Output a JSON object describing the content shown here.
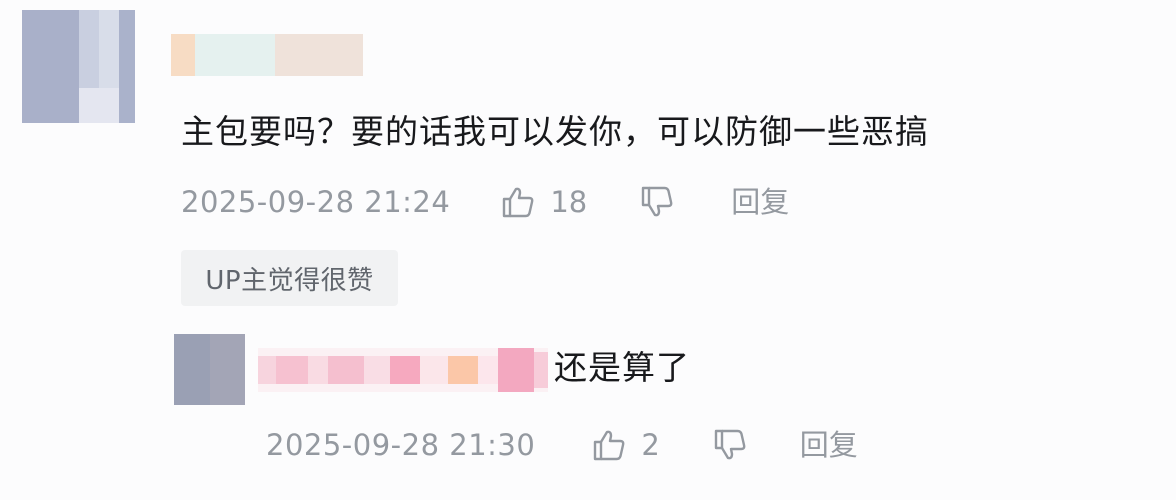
{
  "comment": {
    "text": "主包要吗？要的话我可以发你，可以防御一些恶搞",
    "timestamp": "2025-09-28 21:24",
    "like_icon": "thumbs-up-icon",
    "like_count": "18",
    "dislike_icon": "thumbs-down-icon",
    "reply_label": "回复",
    "up_badge": "UP主觉得很赞"
  },
  "reply": {
    "text": "还是算了",
    "timestamp": "2025-09-28 21:30",
    "like_icon": "thumbs-up-icon",
    "like_count": "2",
    "dislike_icon": "thumbs-down-icon",
    "reply_label": "回复"
  },
  "colors": {
    "text": "#18191c",
    "meta": "#9499a0",
    "badge_bg": "#f1f2f3",
    "badge_text": "#61666d"
  }
}
